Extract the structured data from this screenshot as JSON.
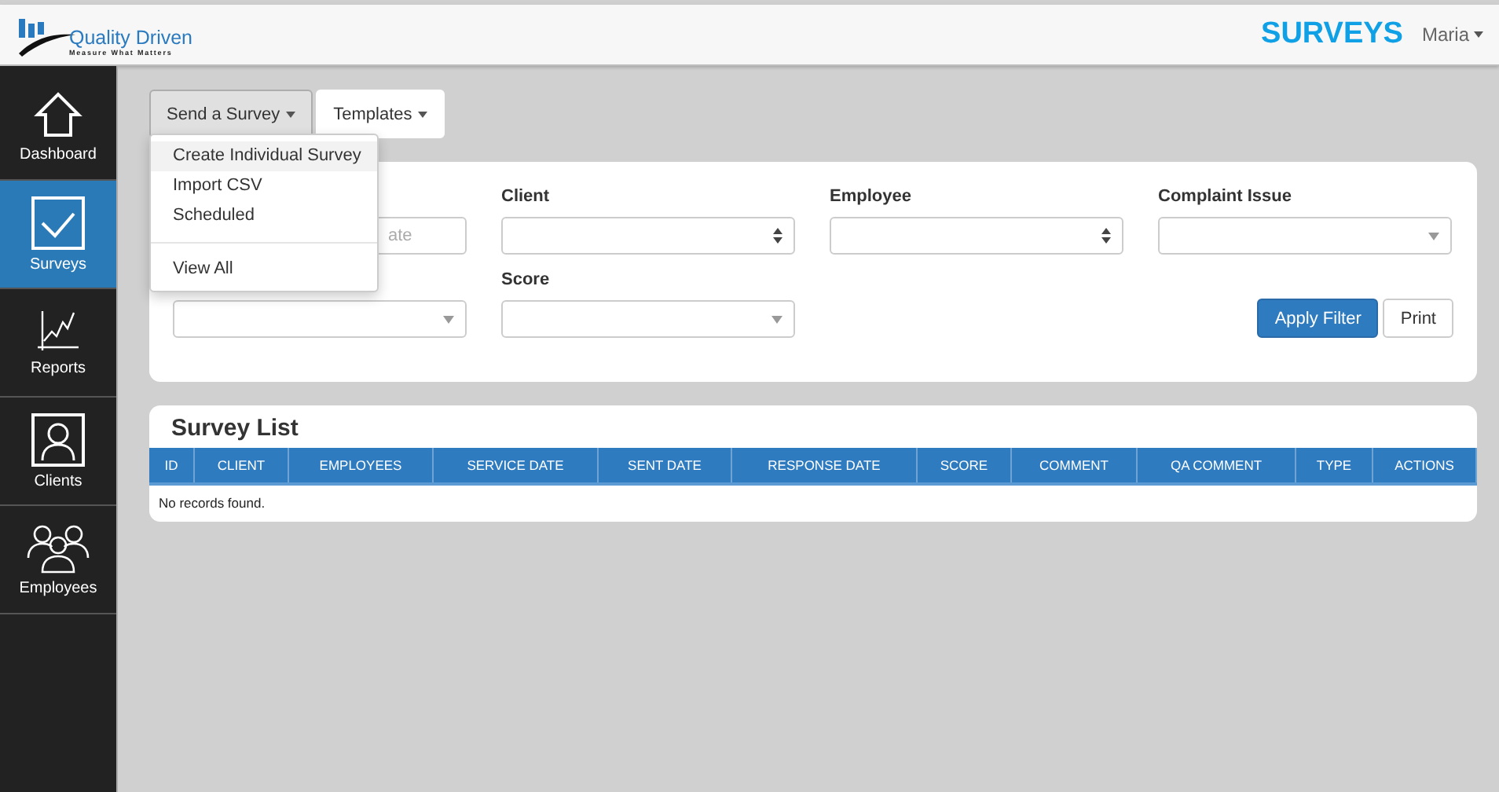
{
  "header": {
    "logo_name": "Quality Driven",
    "logo_tagline": "Measure What Matters",
    "page_title": "SURVEYS",
    "user": "Maria"
  },
  "sidebar": {
    "items": [
      {
        "label": "Dashboard",
        "kind": "home",
        "selected": false
      },
      {
        "label": "Surveys",
        "kind": "check",
        "selected": true
      },
      {
        "label": "Reports",
        "kind": "chart",
        "selected": false
      },
      {
        "label": "Clients",
        "kind": "person",
        "selected": false
      },
      {
        "label": "Employees",
        "kind": "people",
        "selected": false
      }
    ]
  },
  "toolbar": [
    {
      "label": "Send a Survey",
      "selected": true
    },
    {
      "label": "Templates",
      "selected": false
    }
  ],
  "dropdown": {
    "items": [
      {
        "label": "Create Individual Survey",
        "selected": true
      },
      {
        "label": "Import CSV",
        "selected": false
      },
      {
        "label": "Scheduled",
        "selected": false
      },
      {
        "kind": "divider"
      },
      {
        "label": "View All",
        "selected": false
      }
    ]
  },
  "filters": {
    "rows": [
      [
        {
          "kind": "text",
          "placeholder": "ate"
        },
        {
          "kind": "spinner",
          "label": "Client"
        },
        {
          "kind": "spinner",
          "label": "Employee"
        },
        {
          "kind": "select",
          "label": "Complaint Issue"
        }
      ],
      [
        {
          "kind": "select"
        },
        {
          "kind": "select",
          "label": "Score"
        }
      ]
    ],
    "buttons": [
      {
        "label": "Apply Filter",
        "kind": "primary"
      },
      {
        "label": "Print",
        "kind": "default"
      }
    ]
  },
  "table": {
    "title": "Survey List",
    "columns": [
      "ID",
      "CLIENT",
      "EMPLOYEES",
      "SERVICE DATE",
      "SENT DATE",
      "RESPONSE DATE",
      "SCORE",
      "COMMENT",
      "QA COMMENT",
      "TYPE",
      "ACTIONS"
    ],
    "empty_message": "No records found."
  }
}
